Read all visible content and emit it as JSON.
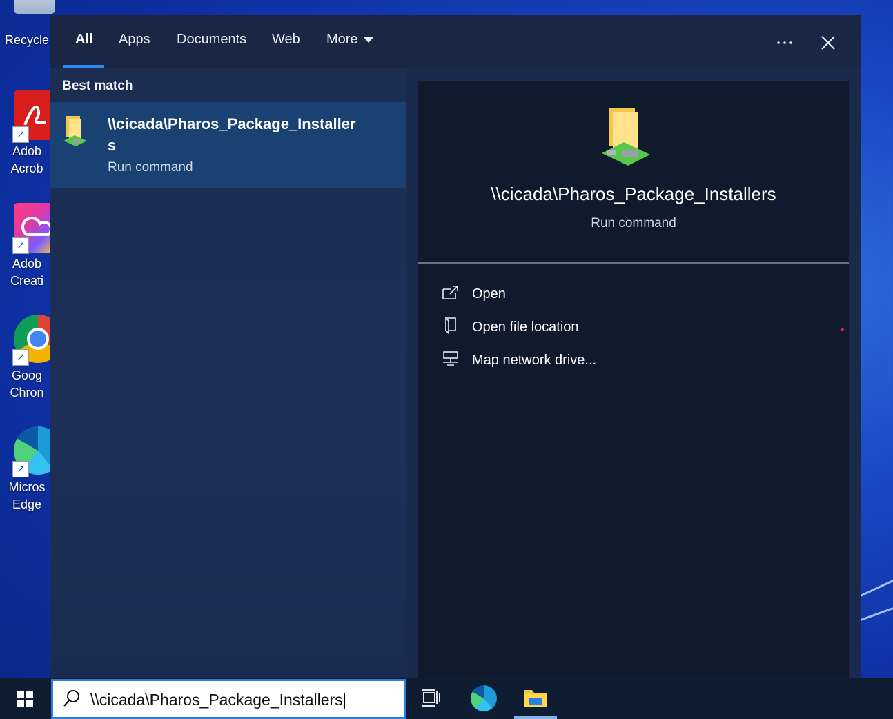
{
  "desktop": {
    "icons": [
      {
        "name": "recycle-bin",
        "label": "Recycle"
      },
      {
        "name": "adobe-acrobat",
        "label": "Adob\nAcrob"
      },
      {
        "name": "adobe-creative",
        "label": "Adob\nCreati"
      },
      {
        "name": "google-chrome",
        "label": "Goog\nChron"
      },
      {
        "name": "microsoft-edge",
        "label": "Micros\nEdge"
      }
    ]
  },
  "search_flyout": {
    "tabs": [
      {
        "label": "All",
        "active": true
      },
      {
        "label": "Apps"
      },
      {
        "label": "Documents"
      },
      {
        "label": "Web"
      },
      {
        "label": "More"
      }
    ],
    "more_icon": "ellipsis-icon",
    "close_icon": "close-icon",
    "best_match_label": "Best match",
    "best_match": {
      "title": "\\\\cicada\\Pharos_Package_Installers",
      "subtitle": "Run command",
      "icon": "network-folder-icon"
    },
    "preview": {
      "title": "\\\\cicada\\Pharos_Package_Installers",
      "subtitle": "Run command",
      "actions": [
        {
          "label": "Open",
          "icon": "open-icon"
        },
        {
          "label": "Open file location",
          "icon": "file-location-icon"
        },
        {
          "label": "Map network drive...",
          "icon": "network-drive-icon"
        }
      ]
    }
  },
  "taskbar": {
    "search_value": "\\\\cicada\\Pharos_Package_Installers",
    "items": [
      "task-view-icon",
      "edge-icon",
      "file-explorer-icon"
    ]
  },
  "colors": {
    "accent": "#2f8df0",
    "flyout_bg": "#1a2a4c",
    "selected_bg": "#194272",
    "taskbar_bg": "#0f1d33"
  }
}
